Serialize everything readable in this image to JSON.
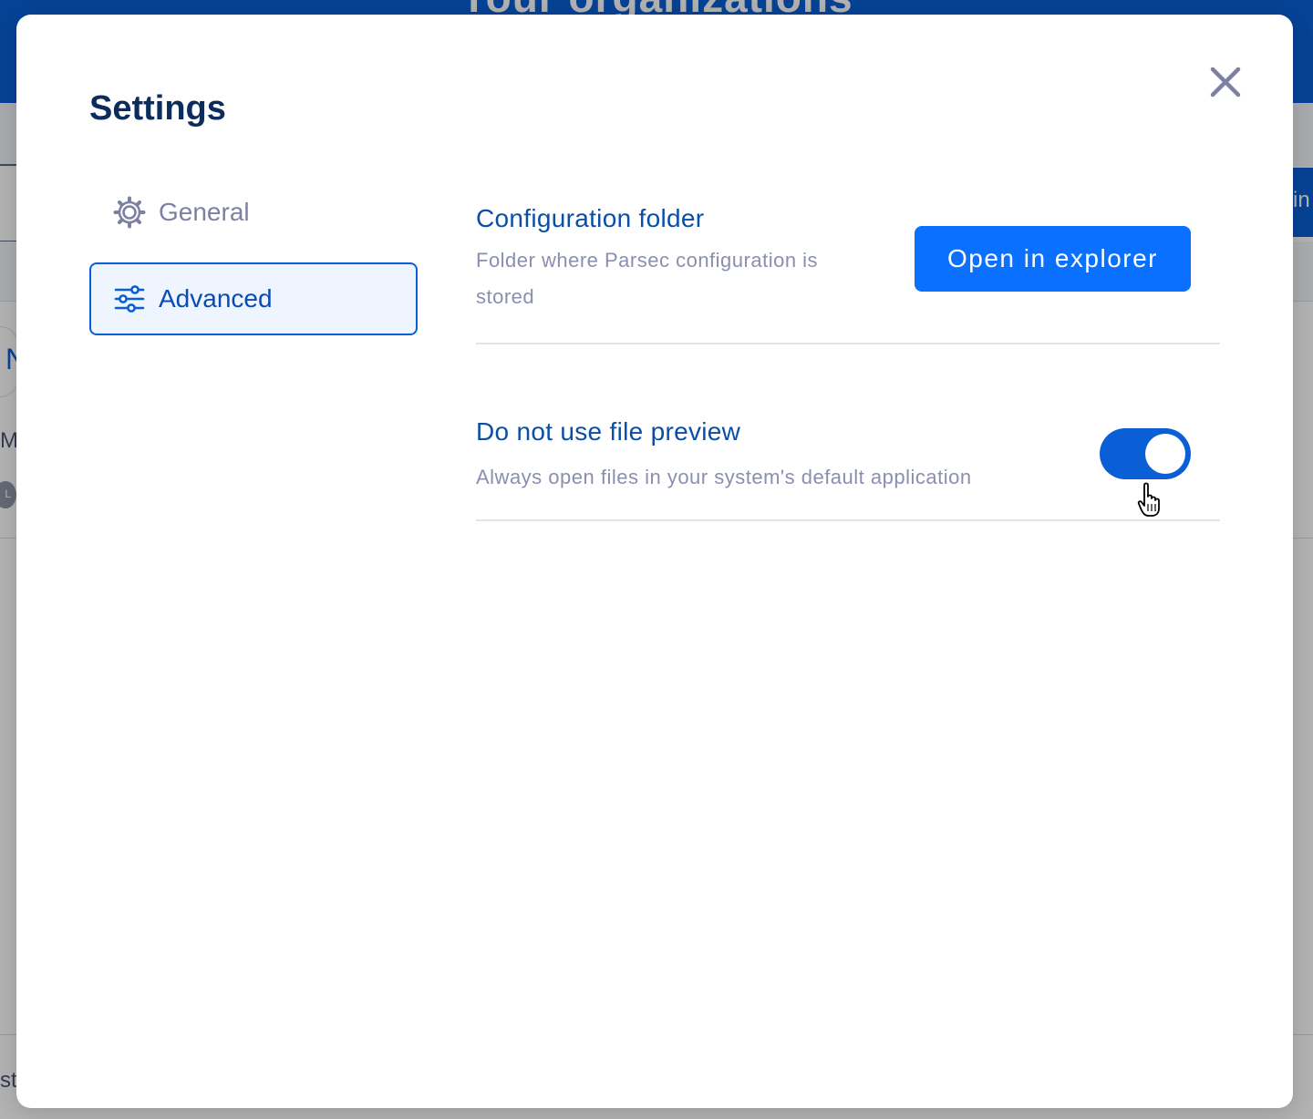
{
  "background": {
    "header_title": "Your organizations",
    "fragments": {
      "card_letter": "N",
      "row_letters": "Ma",
      "avatar_letter": "L",
      "right_button_text": "in",
      "footer_letters": "st"
    }
  },
  "modal": {
    "title": "Settings",
    "close_icon": "close-icon"
  },
  "sidebar": {
    "items": [
      {
        "label": "General",
        "icon": "gear-icon",
        "selected": false
      },
      {
        "label": "Advanced",
        "icon": "sliders-icon",
        "selected": true
      }
    ]
  },
  "settings": {
    "config_folder": {
      "title": "Configuration folder",
      "description": "Folder where Parsec configuration is stored",
      "button_label": "Open in explorer"
    },
    "file_preview": {
      "title": "Do not use file preview",
      "description": "Always open files in your system's default application",
      "enabled": true
    }
  },
  "colors": {
    "primary": "#0a5fd6",
    "button": "#0a70ff",
    "title": "#0b2d5e",
    "muted": "#8a8fb0"
  }
}
